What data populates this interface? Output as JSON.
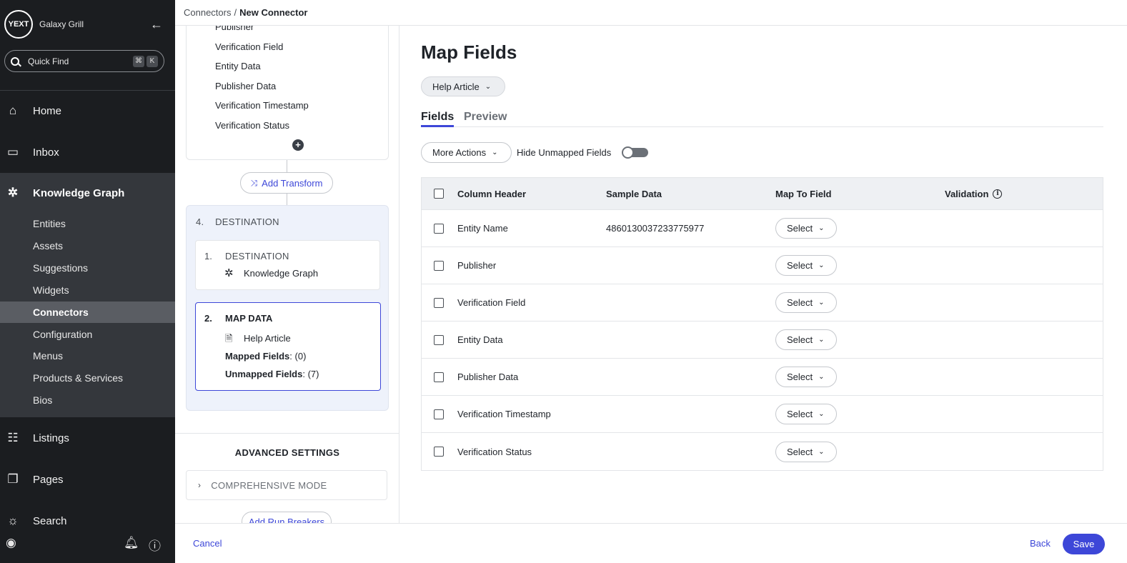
{
  "sidebar": {
    "logo_text": "YEXT",
    "account_name": "Galaxy Grill",
    "quick_find": {
      "placeholder": "Quick Find",
      "shortcut_mod": "⌘",
      "shortcut_key": "K"
    },
    "nav": [
      {
        "label": "Home",
        "icon": "home-icon"
      },
      {
        "label": "Inbox",
        "icon": "inbox-icon"
      },
      {
        "label": "Knowledge Graph",
        "icon": "knowledge-graph-icon"
      },
      {
        "label": "Listings",
        "icon": "listings-icon"
      },
      {
        "label": "Pages",
        "icon": "pages-icon"
      },
      {
        "label": "Search",
        "icon": "search-lightbulb-icon"
      }
    ],
    "kg_sub": [
      "Entities",
      "Assets",
      "Suggestions",
      "Widgets",
      "Connectors",
      "Configuration",
      "Menus",
      "Products & Services",
      "Bios"
    ],
    "active_sub": "Connectors"
  },
  "breadcrumb": {
    "parent": "Connectors",
    "separator": "/",
    "current": "New Connector"
  },
  "pipeline": {
    "fields": [
      "Publisher",
      "Verification Field",
      "Entity Data",
      "Publisher Data",
      "Verification Timestamp",
      "Verification Status"
    ],
    "add_transform": "Add Transform",
    "destination_step": {
      "number": "4.",
      "label": "DESTINATION"
    },
    "destination_inner": {
      "number": "1.",
      "label": "DESTINATION",
      "target": "Knowledge Graph"
    },
    "map_data": {
      "number": "2.",
      "label": "MAP DATA",
      "entity_type": "Help Article",
      "mapped_label": "Mapped Fields",
      "mapped_count": ": (0)",
      "unmapped_label": "Unmapped Fields",
      "unmapped_count": ": (7)"
    },
    "advanced_settings": "ADVANCED SETTINGS",
    "comprehensive_mode": "COMPREHENSIVE MODE",
    "add_run_breakers": "Add Run Breakers"
  },
  "main": {
    "title": "Map Fields",
    "entity_type_dropdown": "Help Article",
    "tabs": [
      "Fields",
      "Preview"
    ],
    "more_actions": "More Actions",
    "hide_unmapped_label": "Hide Unmapped Fields",
    "hide_unmapped_on": false,
    "table": {
      "headers": [
        "Column Header",
        "Sample Data",
        "Map To Field",
        "Validation"
      ],
      "rows": [
        {
          "column": "Entity Name",
          "sample": "4860130037233775977",
          "map": "Select"
        },
        {
          "column": "Publisher",
          "sample": "",
          "map": "Select"
        },
        {
          "column": "Verification Field",
          "sample": "",
          "map": "Select"
        },
        {
          "column": "Entity Data",
          "sample": "",
          "map": "Select"
        },
        {
          "column": "Publisher Data",
          "sample": "",
          "map": "Select"
        },
        {
          "column": "Verification Timestamp",
          "sample": "",
          "map": "Select"
        },
        {
          "column": "Verification Status",
          "sample": "",
          "map": "Select"
        }
      ]
    }
  },
  "footer": {
    "cancel": "Cancel",
    "back": "Back",
    "save": "Save"
  },
  "colors": {
    "accent": "#3d47d8",
    "sidebar_bg": "#1b1d20",
    "sidebar_section_bg": "#34373c",
    "active_item_bg": "#5a5d63"
  }
}
